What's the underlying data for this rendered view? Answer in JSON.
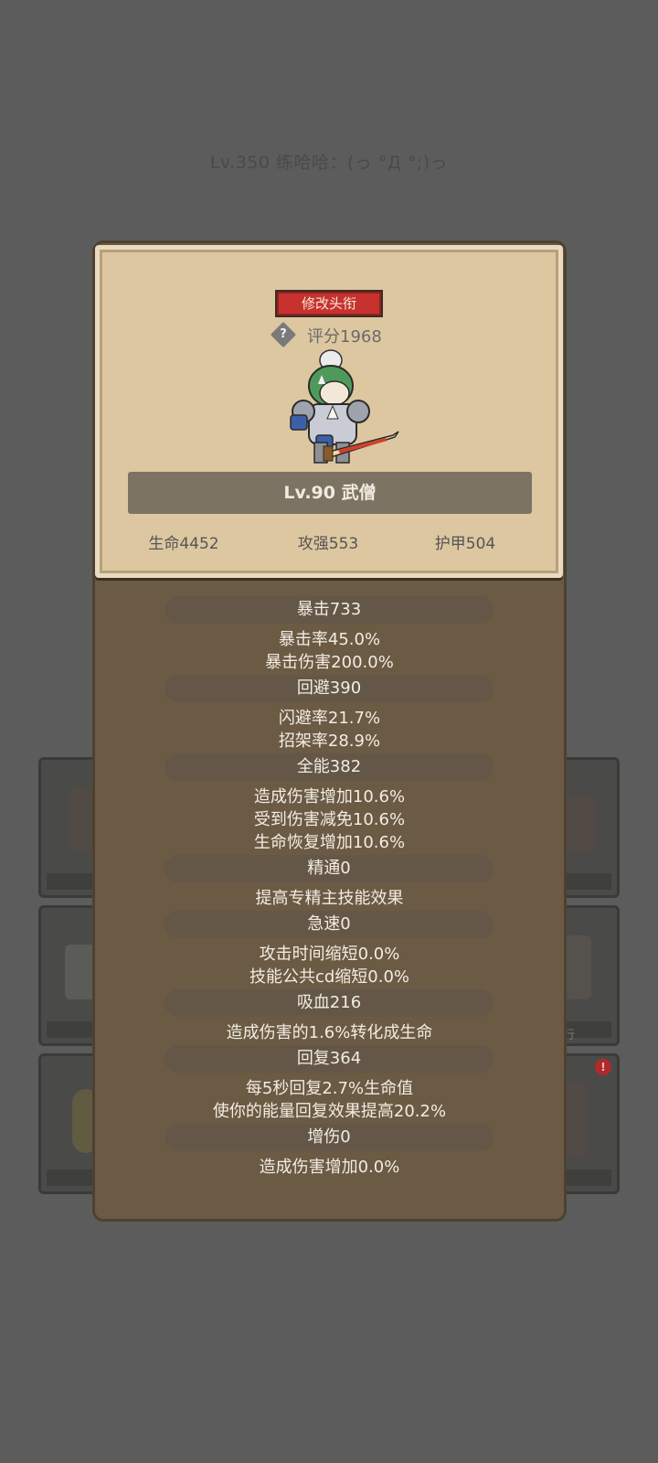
{
  "page": {
    "title": "Lv.350 练哈哈：(っ °Д °;)っ"
  },
  "modal": {
    "rename_label": "修改头衔",
    "help_glyph": "?",
    "score": "评分1968",
    "hero_icon": "knight-character-icon",
    "name": "Lv.90 武僧",
    "base_stats": [
      "生命4452",
      "攻强553",
      "护甲504"
    ]
  },
  "stats": [
    {
      "header": "暴击733",
      "lines": [
        "暴击率45.0%",
        "暴击伤害200.0%"
      ]
    },
    {
      "header": "回避390",
      "lines": [
        "闪避率21.7%",
        "招架率28.9%"
      ]
    },
    {
      "header": "全能382",
      "lines": [
        "造成伤害增加10.6%",
        "受到伤害减免10.6%",
        "生命恢复增加10.6%"
      ]
    },
    {
      "header": "精通0",
      "lines": [
        "提高专精主技能效果"
      ]
    },
    {
      "header": "急速0",
      "lines": [
        "攻击时间缩短0.0%",
        "技能公共cd缩短0.0%"
      ]
    },
    {
      "header": "吸血216",
      "lines": [
        "造成伤害的1.6%转化成生命"
      ]
    },
    {
      "header": "回复364",
      "lines": [
        "每5秒回复2.7%生命值",
        "使你的能量回复效果提高20.2%"
      ]
    },
    {
      "header": "增伤0",
      "lines": [
        "造成伤害增加0.0%"
      ]
    }
  ],
  "background": {
    "partial_text": "行",
    "alert": "!"
  },
  "colors": {
    "accent_red": "#c7322e",
    "parchment": "#ddc7a0",
    "panel": "#6b5a44"
  }
}
